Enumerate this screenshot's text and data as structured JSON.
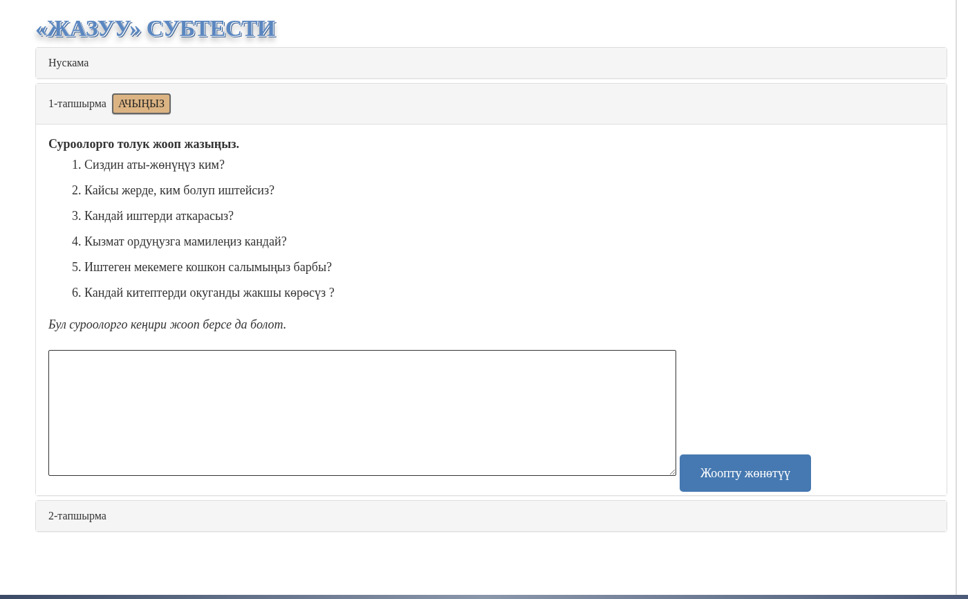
{
  "title": "«ЖАЗУУ» СУБТЕСТИ",
  "panels": [
    {
      "title": "Нускама",
      "expanded": false
    },
    {
      "title": "1-тапшырма",
      "expanded": true,
      "open_button": "АЧЫҢЫЗ",
      "body": {
        "instruction": "Суроолорго толук жооп жазыңыз.",
        "questions": [
          "1. Сиздин аты-жөнүңүз ким?",
          "2. Кайсы жерде, ким болуп иштейсиз?",
          "3. Кандай иштерди аткарасыз?",
          "4. Кызмат ордуңузга мамилеңиз кандай?",
          "5. Иштеген мекемеге кошкон салымыңыз барбы?",
          "6. Кандай китептерди окуганды жакшы көрөсүз ?"
        ],
        "note": "Бул суроолорго кеңири жооп берсе да болот.",
        "submit_button": "Жоопту жөнөтүү"
      }
    },
    {
      "title": "2-тапшырма",
      "expanded": false
    }
  ]
}
